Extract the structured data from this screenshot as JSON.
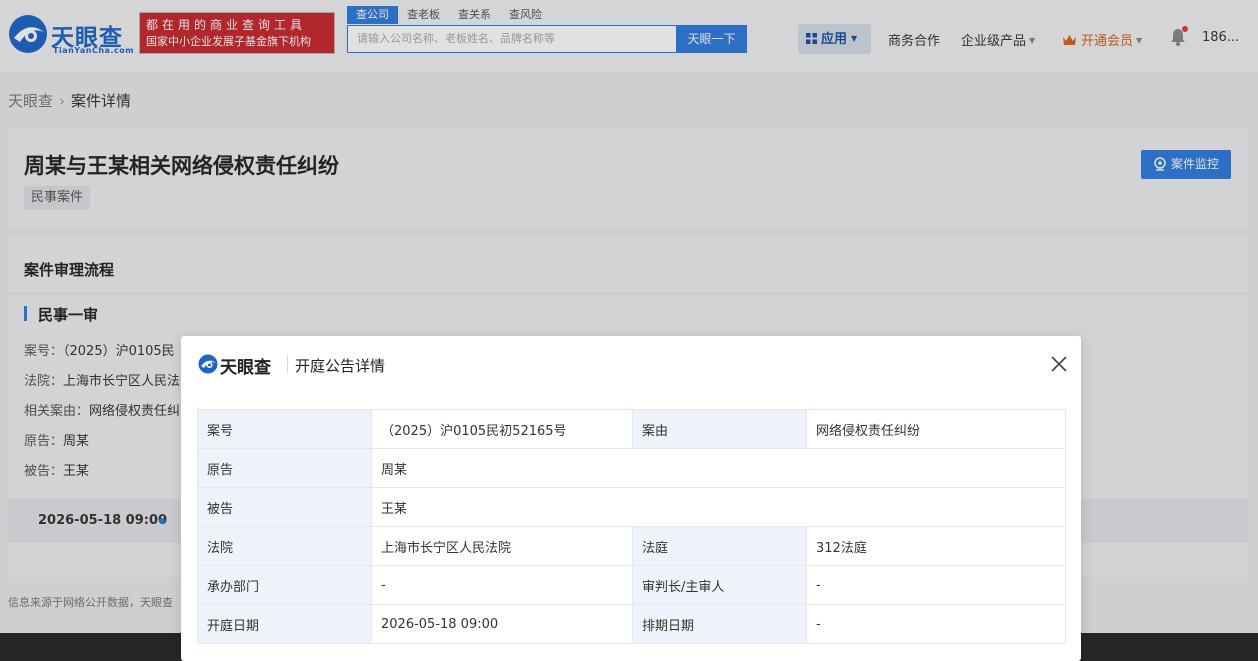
{
  "header": {
    "logo_text": "天眼查",
    "logo_sub": "TianYanCha.com",
    "slogan_line1": "都在用的商业查询工具",
    "slogan_line2": "国家中小企业发展子基金旗下机构",
    "search_tabs": [
      "查公司",
      "查老板",
      "查关系",
      "查风险"
    ],
    "search_placeholder": "请输入公司名称、老板姓名、品牌名称等",
    "search_button": "天眼一下",
    "nav": {
      "app": "应用",
      "business": "商务合作",
      "enterprise": "企业级产品",
      "vip": "开通会员",
      "user": "186..."
    }
  },
  "breadcrumb": {
    "home": "天眼查",
    "current": "案件详情"
  },
  "case": {
    "title": "周某与王某相关网络侵权责任纠纷",
    "tag": "民事案件",
    "monitor_button": "案件监控"
  },
  "process": {
    "title": "案件审理流程",
    "stage": "民事一审",
    "lines": [
      {
        "label": "案号：",
        "value": "（2025）沪0105民"
      },
      {
        "label": "法院：",
        "value": "上海市长宁区人民法"
      },
      {
        "label": "相关案由：",
        "value": "网络侵权责任纠"
      },
      {
        "label": "原告：",
        "value": "周某"
      },
      {
        "label": "被告：",
        "value": "王某"
      }
    ],
    "hearing_date": "2026-05-18 09:00"
  },
  "source_note": "信息来源于网络公开数据，天眼查",
  "modal": {
    "logo_text": "天眼查",
    "title": "开庭公告详情",
    "rows": {
      "case_no_label": "案号",
      "case_no": "（2025）沪0105民初52165号",
      "cause_label": "案由",
      "cause": "网络侵权责任纠纷",
      "plaintiff_label": "原告",
      "plaintiff": "周某",
      "defendant_label": "被告",
      "defendant": "王某",
      "court_label": "法院",
      "court": "上海市长宁区人民法院",
      "courtroom_label": "法庭",
      "courtroom": "312法庭",
      "dept_label": "承办部门",
      "dept": "-",
      "judge_label": "审判长/主审人",
      "judge": "-",
      "date_label": "开庭日期",
      "date": "2026-05-18 09:00",
      "schedule_label": "排期日期",
      "schedule": "-"
    }
  }
}
